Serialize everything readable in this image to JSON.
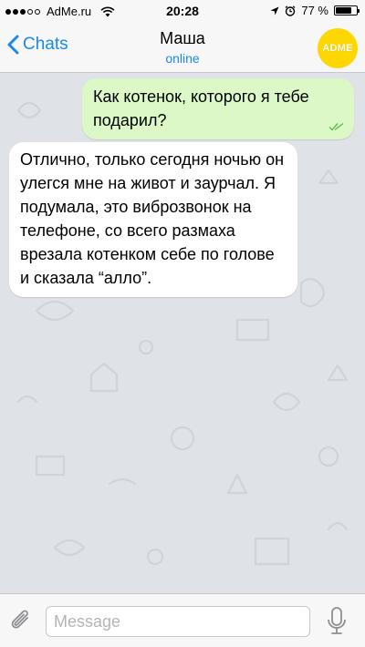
{
  "status_bar": {
    "carrier": "AdMe.ru",
    "time": "20:28",
    "battery_percent": "77 %",
    "battery_level": 0.77
  },
  "nav": {
    "back_label": "Chats",
    "contact_name": "Маша",
    "contact_status": "online",
    "avatar_text": "ADME"
  },
  "messages": [
    {
      "direction": "outgoing",
      "text": "Как котенок, которого я тебе подарил?",
      "status": "read"
    },
    {
      "direction": "incoming",
      "text": "Отлично, только сегодня ночью он улегся мне на живот и заурчал. Я подумала, это виброзвонок на телефоне, со всего размаха врезала котенком себе по голове и сказала “алло”."
    }
  ],
  "input": {
    "placeholder": "Message"
  },
  "colors": {
    "accent": "#1b88ee",
    "outgoing_bubble": "#dcf8c6",
    "incoming_bubble": "#ffffff",
    "avatar": "#ffd700",
    "read_ticks": "#5fba52"
  },
  "icons": [
    "signal-icon",
    "wifi-icon",
    "location-arrow-icon",
    "alarm-icon",
    "battery-icon",
    "chevron-left-icon",
    "double-check-icon",
    "paperclip-icon",
    "microphone-icon"
  ]
}
